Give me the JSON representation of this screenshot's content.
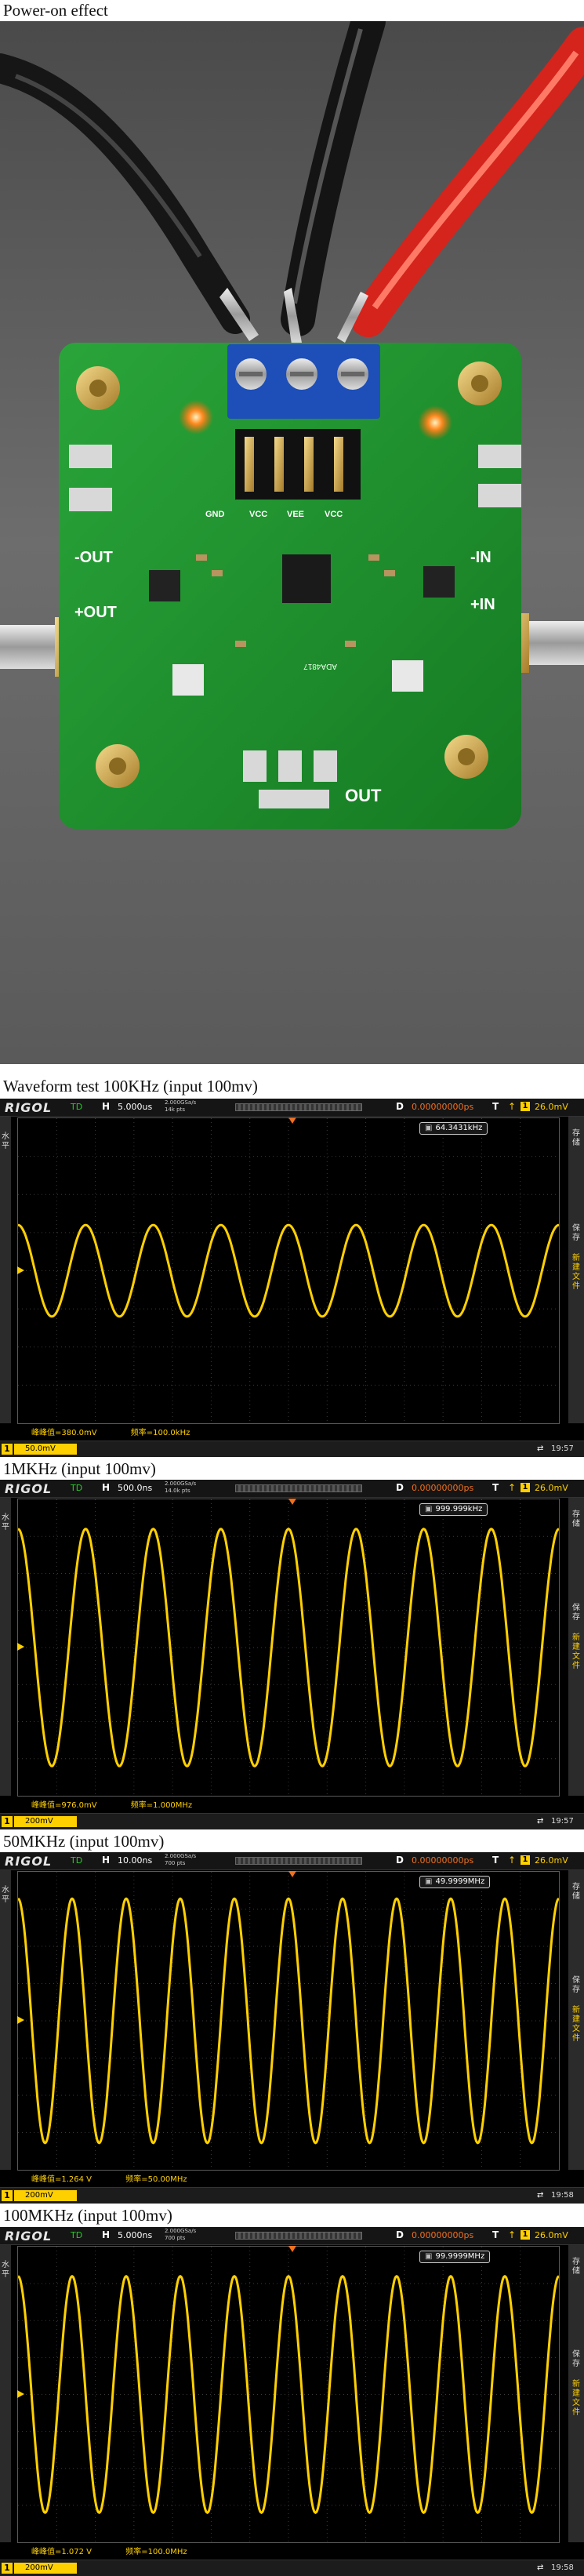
{
  "captions": {
    "photo": "Power-on effect",
    "s1": "Waveform test 100KHz (input 100mv)",
    "s2": "1MKHz (input 100mv)",
    "s3": "50MKHz (input 100mv)",
    "s4": "100MKHz (input 100mv)"
  },
  "board": {
    "pins_top": [
      "GND",
      "VCC",
      "VEE",
      "VCC"
    ],
    "left_labels": [
      "-OUT",
      "+OUT"
    ],
    "right_labels": [
      "-IN",
      "+IN"
    ],
    "bottom_label": "OUT",
    "model_text": "ADA4817"
  },
  "scopes": [
    {
      "brand": "RIGOL",
      "mode": "TD",
      "h": "H",
      "timebase": "5.000us",
      "srate1": "2.000GSa/s",
      "srate2": "14k pts",
      "d": "D",
      "delay": "0.00000000ps",
      "t": "T",
      "trig_level": "26.0mV",
      "freq_counter": "64.3431kHz",
      "meas_a": "峰峰值=380.0mV",
      "meas_b": "频率=100.0kHz",
      "ch_scale": "50.0mV",
      "ch_num": "1",
      "time": "19:57",
      "cycles": 8,
      "amp": 0.3
    },
    {
      "brand": "RIGOL",
      "mode": "TD",
      "h": "H",
      "timebase": "500.0ns",
      "srate1": "2.000GSa/s",
      "srate2": "14.0k pts",
      "d": "D",
      "delay": "0.00000000ps",
      "t": "T",
      "trig_level": "26.0mV",
      "freq_counter": "999.999kHz",
      "meas_a": "峰峰值=976.0mV",
      "meas_b": "频率=1.000MHz",
      "ch_scale": "200mV",
      "ch_num": "1",
      "time": "19:57",
      "cycles": 8,
      "amp": 0.8
    },
    {
      "brand": "RIGOL",
      "mode": "TD",
      "h": "H",
      "timebase": "10.00ns",
      "srate1": "2.000GSa/s",
      "srate2": "700 pts",
      "d": "D",
      "delay": "0.00000000ps",
      "t": "T",
      "trig_level": "26.0mV",
      "freq_counter": "49.9999MHz",
      "meas_a": "峰峰值=1.264 V",
      "meas_b": "频率=50.00MHz",
      "ch_scale": "200mV",
      "ch_num": "1",
      "time": "19:58",
      "cycles": 10,
      "amp": 0.82
    },
    {
      "brand": "RIGOL",
      "mode": "TD",
      "h": "H",
      "timebase": "5.000ns",
      "srate1": "2.000GSa/s",
      "srate2": "700 pts",
      "d": "D",
      "delay": "0.00000000ps",
      "t": "T",
      "trig_level": "26.0mV",
      "freq_counter": "99.9999MHz",
      "meas_a": "峰峰值=1.072 V",
      "meas_b": "频率=100.0MHz",
      "ch_scale": "200mV",
      "ch_num": "1",
      "time": "19:58",
      "cycles": 10,
      "amp": 0.8
    }
  ],
  "side_panel": {
    "left": "水平",
    "right_top": "存储",
    "right_mid": "保存",
    "right_new": "新建文件"
  },
  "colors": {
    "trace": "#ffd000",
    "pcb": "#1e8a2a",
    "screen_bg": "#000000"
  }
}
